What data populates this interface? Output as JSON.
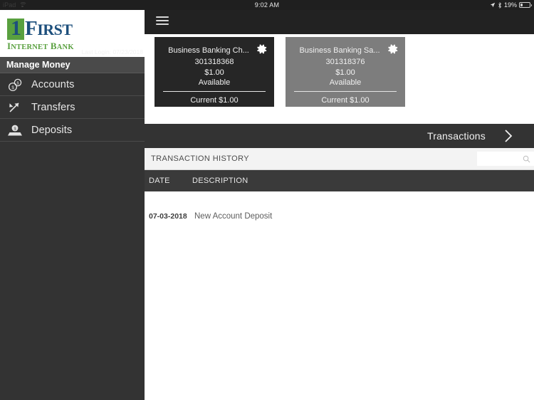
{
  "status_bar": {
    "device_label": "iPad",
    "wifi_icon": "wifi-icon",
    "time": "9:02 AM",
    "location_icon": "location-arrow-icon",
    "bluetooth_icon": "bluetooth-icon",
    "battery_percent": "19%",
    "battery_icon": "battery-low-icon"
  },
  "sidebar": {
    "logo": {
      "mark": "1",
      "word": "FIRST",
      "word_cap": "F",
      "word_rest": "IRST",
      "tagline_cap1": "I",
      "tagline_rest1": "NTERNET",
      "tagline_cap2": "B",
      "tagline_rest2": "ANK",
      "brand_green": "#59a03f",
      "brand_blue": "#1d4f7c"
    },
    "last_login": "Last Login: 07/23/2018",
    "section_title": "Manage Money",
    "items": [
      {
        "label": "Accounts",
        "icon": "coins-icon"
      },
      {
        "label": "Transfers",
        "icon": "transfer-arrows-icon"
      },
      {
        "label": "Deposits",
        "icon": "deposit-inbox-icon"
      }
    ]
  },
  "topbar": {
    "menu_icon": "hamburger-menu-icon"
  },
  "accounts": [
    {
      "title": "Business Banking Ch...",
      "number": "301318368",
      "balance": "$1.00",
      "balance_label": "Available",
      "current": "Current $1.00",
      "gear_icon": "gear-icon",
      "selected": true
    },
    {
      "title": "Business Banking Sa...",
      "number": "301318376",
      "balance": "$1.00",
      "balance_label": "Available",
      "current": "Current $1.00",
      "gear_icon": "gear-icon",
      "selected": false
    }
  ],
  "transactions_bar": {
    "label": "Transactions",
    "chevron_icon": "chevron-right-icon"
  },
  "history": {
    "title": "TRANSACTION HISTORY",
    "search_value": "",
    "search_placeholder": "",
    "search_icon": "search-icon",
    "columns": {
      "date": "DATE",
      "description": "DESCRIPTION"
    },
    "rows": [
      {
        "date": "07-03-2018",
        "description": "New Account Deposit"
      }
    ]
  },
  "colors": {
    "sidebar_bg": "#333333",
    "topbar_bg": "#222222",
    "card_selected_bg": "#262626",
    "card_unselected_bg": "#7d7d7d",
    "tx_bar_bg": "#333333",
    "col_header_bg": "#3a3a3a"
  }
}
